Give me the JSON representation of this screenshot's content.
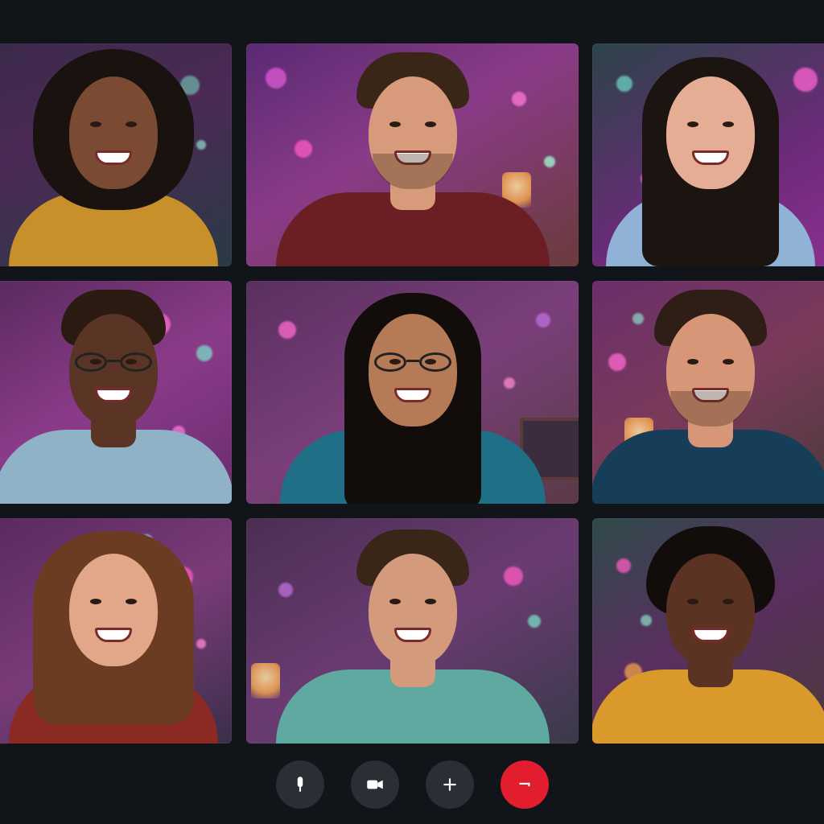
{
  "app": {
    "colors": {
      "background": "#111519",
      "control_bg": "#2a2f35",
      "end_call": "#e11d2e"
    }
  },
  "participants": [
    {
      "position": "row1-col1",
      "shirt_color": "#c7902b",
      "skin": "#7a4a32",
      "hair_color": "#1a120f",
      "hair_style": "curly-afro"
    },
    {
      "position": "row1-col2",
      "shirt_color": "#6b1e24",
      "skin": "#d79a7a",
      "hair_color": "#3a2619",
      "hair_style": "short"
    },
    {
      "position": "row1-col3",
      "shirt_color": "#8fb2d6",
      "skin": "#e6ad95",
      "hair_color": "#1c1410",
      "hair_style": "long"
    },
    {
      "position": "row2-col1",
      "shirt_color": "#8fb2c7",
      "skin": "#5a3424",
      "hair_color": "#2b1a12",
      "hair_style": "bald",
      "glasses": true
    },
    {
      "position": "row2-col2",
      "shirt_color": "#1f6f87",
      "skin": "#b57a56",
      "hair_color": "#120c0a",
      "hair_style": "long",
      "glasses": true
    },
    {
      "position": "row2-col3",
      "shirt_color": "#173e58",
      "skin": "#d89678",
      "hair_color": "#2e1e15",
      "hair_style": "short"
    },
    {
      "position": "row3-col1",
      "shirt_color": "#8a2a22",
      "skin": "#e2a688",
      "hair_color": "#6b3b22",
      "hair_style": "shoulder"
    },
    {
      "position": "row3-col2",
      "shirt_color": "#5fa9a0",
      "skin": "#d49a7c",
      "hair_color": "#3a2619",
      "hair_style": "short"
    },
    {
      "position": "row3-col3",
      "shirt_color": "#d99a2b",
      "skin": "#5b3322",
      "hair_color": "#120c0a",
      "hair_style": "short-afro"
    }
  ],
  "controls": [
    {
      "name": "microphone",
      "icon": "microphone-icon"
    },
    {
      "name": "camera",
      "icon": "video-camera-icon"
    },
    {
      "name": "add-participant",
      "icon": "plus-icon"
    },
    {
      "name": "end-call",
      "icon": "end-call-icon"
    }
  ]
}
